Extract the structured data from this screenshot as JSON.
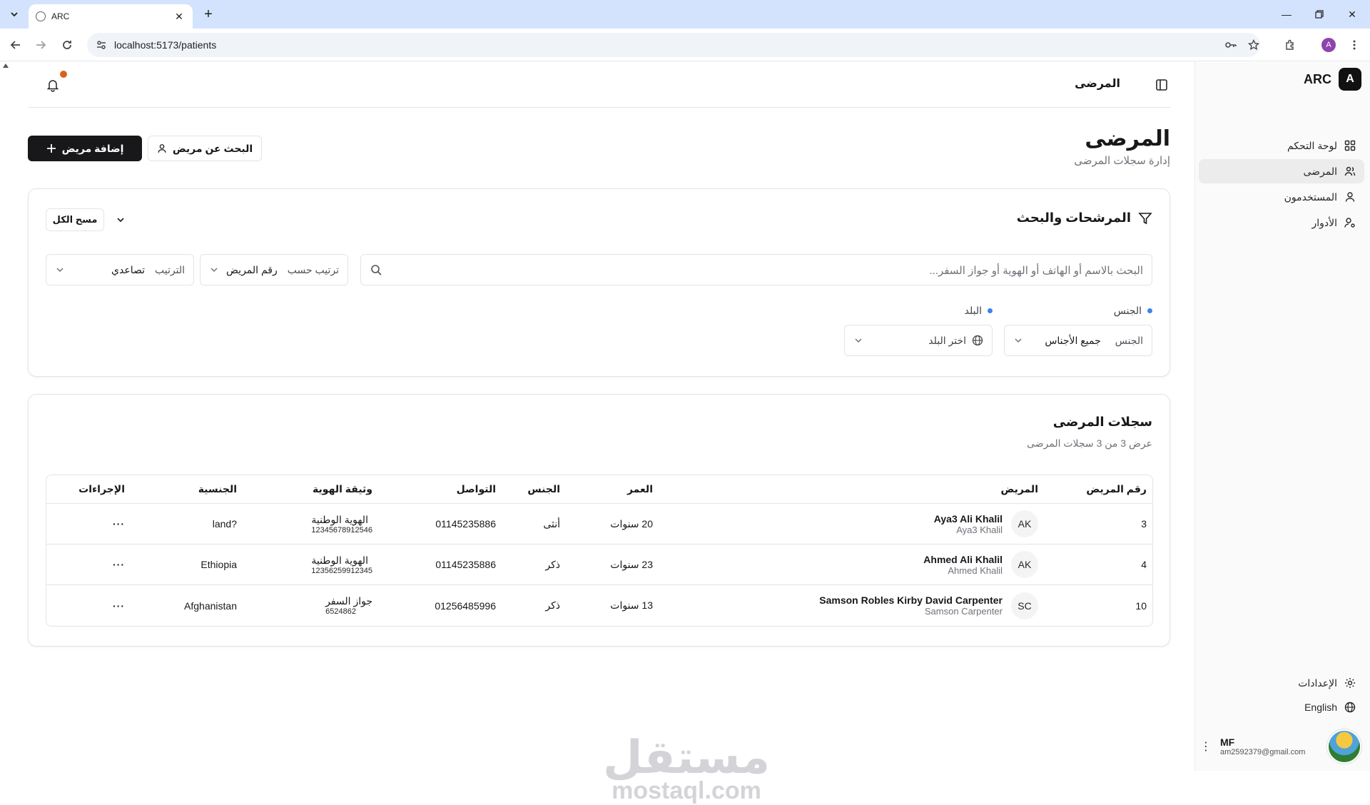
{
  "browser": {
    "tab_title": "ARC",
    "url": "localhost:5173/patients",
    "profile_initial": "A"
  },
  "sidebar": {
    "brand_logo": "A",
    "brand_name": "ARC",
    "items": [
      {
        "label": "لوحة التحكم",
        "icon": "dashboard-icon"
      },
      {
        "label": "المرضى",
        "icon": "users-icon",
        "active": true
      },
      {
        "label": "المستخدمون",
        "icon": "user-icon"
      },
      {
        "label": "الأدوار",
        "icon": "user-cog-icon"
      }
    ],
    "settings_label": "الإعدادات",
    "language_label": "English",
    "user": {
      "name": "MF",
      "email": "am2592379@gmail.com"
    }
  },
  "topbar": {
    "page_label": "المرضى"
  },
  "header": {
    "title": "المرضى",
    "subtitle": "إدارة سجلات المرضى",
    "add_button": "إضافة مريض",
    "search_button": "البحث عن مريض"
  },
  "filters": {
    "title": "المرشحات والبحث",
    "clear_all": "مسح الكل",
    "search_placeholder": "البحث بالاسم أو الهاتف أو الهوية أو جواز السفر...",
    "sort_by_label": "ترتيب حسب",
    "sort_by_value": "رقم المريض",
    "sort_order_label": "الترتيب",
    "sort_order_value": "تصاعدي",
    "gender_label": "الجنس",
    "gender_field_label": "الجنس",
    "gender_value": "جميع الأجناس",
    "country_label": "البلد",
    "country_placeholder": "اختر البلد"
  },
  "records": {
    "title": "سجلات المرضى",
    "subtitle": "عرض 3 من 3 سجلات المرضى",
    "columns": {
      "id": "رقم المريض",
      "patient": "المريض",
      "age": "العمر",
      "gender": "الجنس",
      "contact": "التواصل",
      "document": "وثيقة الهوية",
      "nationality": "الجنسية",
      "actions": "الإجراءات"
    },
    "rows": [
      {
        "id": "3",
        "initials": "AK",
        "name": "Aya3 Ali Khalil",
        "short_name": "Aya3 Khalil",
        "age": "20 سنوات",
        "gender": "أنثى",
        "contact": "01145235886",
        "doc_type": "الهوية الوطنية",
        "doc_number": "12345678912546",
        "nationality": "land?",
        "actions": "···"
      },
      {
        "id": "4",
        "initials": "AK",
        "name": "Ahmed Ali Khalil",
        "short_name": "Ahmed Khalil",
        "age": "23 سنوات",
        "gender": "ذكر",
        "contact": "01145235886",
        "doc_type": "الهوية الوطنية",
        "doc_number": "12356259912345",
        "nationality": "Ethiopia",
        "actions": "···"
      },
      {
        "id": "10",
        "initials": "SC",
        "name": "Samson Robles Kirby David Carpenter",
        "short_name": "Samson Carpenter",
        "age": "13 سنوات",
        "gender": "ذكر",
        "contact": "01256485996",
        "doc_type": "جواز السفر",
        "doc_number": "6524862",
        "nationality": "Afghanistan",
        "actions": "···"
      }
    ]
  },
  "watermark": {
    "arabic": "مستقل",
    "latin": "mostaql.com"
  },
  "colors": {
    "primary": "#18181b",
    "accent_dot": "#3b82f6",
    "notification": "#d9621a",
    "sidebar_bg": "#fafafa"
  }
}
